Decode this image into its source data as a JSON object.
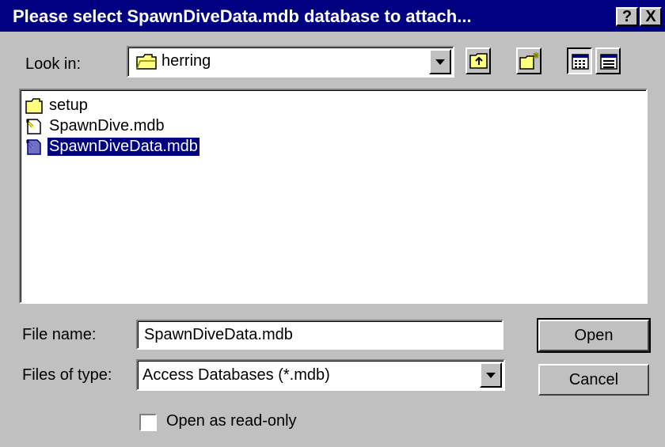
{
  "dialog": {
    "title": "Please select SpawnDiveData.mdb database to attach...",
    "help_label": "?",
    "close_label": "X"
  },
  "look_in": {
    "label": "Look in:",
    "value": "herring"
  },
  "files": [
    {
      "name": "setup",
      "type": "folder"
    },
    {
      "name": "SpawnDive.mdb",
      "type": "mdb"
    },
    {
      "name": "SpawnDiveData.mdb",
      "type": "mdb",
      "selected": true
    }
  ],
  "file_name": {
    "label": "File name:",
    "value": "SpawnDiveData.mdb"
  },
  "files_of_type": {
    "label": "Files of type:",
    "value": "Access Databases (*.mdb)"
  },
  "buttons": {
    "open": "Open",
    "cancel": "Cancel"
  },
  "readonly": {
    "label": "Open as read-only",
    "checked": false
  },
  "colors": {
    "titlebar": "#000080",
    "face": "#c0c0c0",
    "selection": "#000080"
  }
}
